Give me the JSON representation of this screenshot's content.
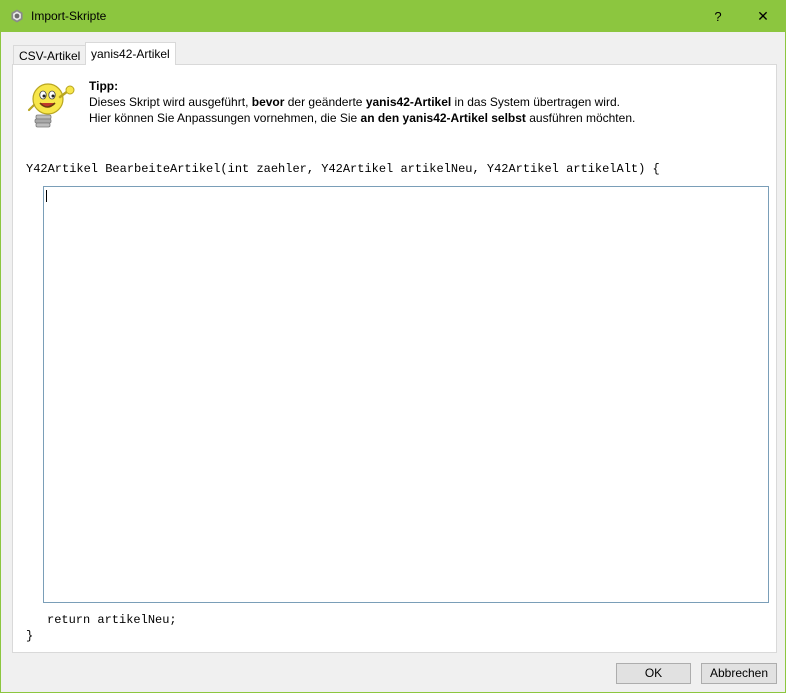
{
  "window": {
    "title": "Import-Skripte",
    "help_label": "?",
    "close_label": "✕"
  },
  "tabs": [
    {
      "label": "CSV-Artikel"
    },
    {
      "label": "yanis42-Artikel",
      "active": true
    }
  ],
  "tip": {
    "title": "Tipp:",
    "line1_part1": "Dieses Skript wird ausgeführt, ",
    "line1_bold1": "bevor",
    "line1_part2": " der geänderte ",
    "line1_bold2": "yanis42-Artikel",
    "line1_part3": " in das System übertragen wird.",
    "line2_part1": "Hier können Sie Anpassungen vornehmen, die Sie ",
    "line2_bold1": "an den yanis42-Artikel selbst",
    "line2_part2": " ausführen möchten."
  },
  "code": {
    "signature": "Y42Artikel BearbeiteArtikel(int zaehler, Y42Artikel artikelNeu, Y42Artikel artikelAlt) {",
    "editor_value": "",
    "return_line": "return artikelNeu;",
    "closing_brace": "}"
  },
  "buttons": {
    "ok": "OK",
    "cancel": "Abbrechen"
  },
  "colors": {
    "titlebar": "#8cc63f",
    "editor_border": "#7a9eb8",
    "tip_bulb": "#f7e64a"
  },
  "icons": {
    "app": "gear-icon",
    "tip": "lightbulb-mascot-icon"
  }
}
